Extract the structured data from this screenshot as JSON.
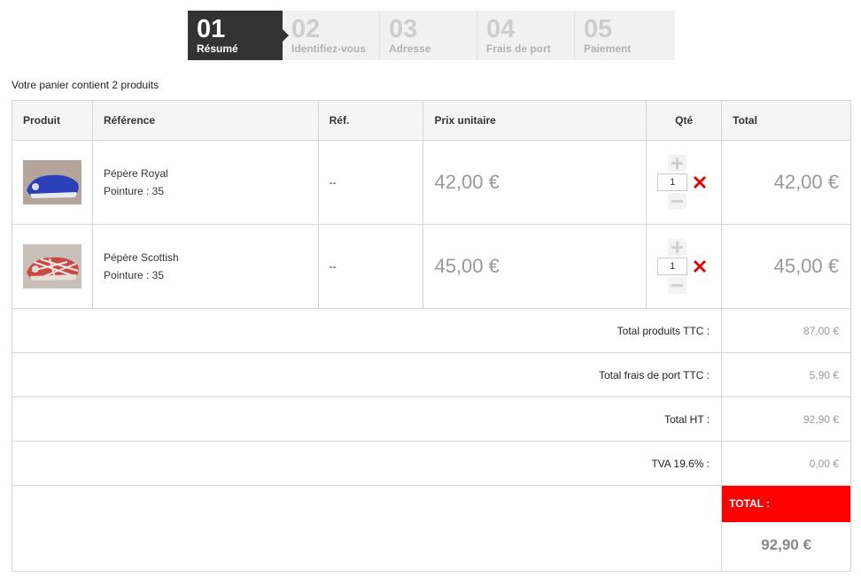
{
  "steps": [
    {
      "num": "01",
      "label": "Résumé"
    },
    {
      "num": "02",
      "label": "Identifiez-vous"
    },
    {
      "num": "03",
      "label": "Adresse"
    },
    {
      "num": "04",
      "label": "Frais de port"
    },
    {
      "num": "05",
      "label": "Paiement"
    }
  ],
  "summary": "Votre panier contient 2 produits",
  "table": {
    "headers": [
      "Produit",
      "Référence",
      "Réf.",
      "Prix unitaire",
      "Qté",
      "Total"
    ],
    "products": [
      {
        "name": "Pépère Royal",
        "size": "Pointure : 35",
        "ref": "--",
        "price": "42,00 €",
        "qty": "1",
        "total": "42,00 €",
        "colors": {
          "main": "#2a3fb8",
          "sole": "#e9e9ee"
        }
      },
      {
        "name": "Pépère Scottish",
        "size": "Pointure : 35",
        "ref": "--",
        "price": "45,00 €",
        "qty": "1",
        "total": "45,00 €",
        "colors": {
          "main": "#c94a45",
          "sole": "#e6e0d8"
        }
      }
    ],
    "totals": [
      {
        "label": "Total produits TTC :",
        "value": "87,00 €"
      },
      {
        "label": "Total frais de port TTC :",
        "value": "5,90 €"
      },
      {
        "label": "Total HT :",
        "value": "92,90 €"
      },
      {
        "label": "TVA 19.6% :",
        "value": "0,00 €"
      }
    ],
    "grand": {
      "label": "TOTAL :",
      "value": "92,90 €"
    }
  },
  "colors": {
    "active_step": "#333333",
    "accent": "#ff0000",
    "muted_price": "#999999"
  }
}
